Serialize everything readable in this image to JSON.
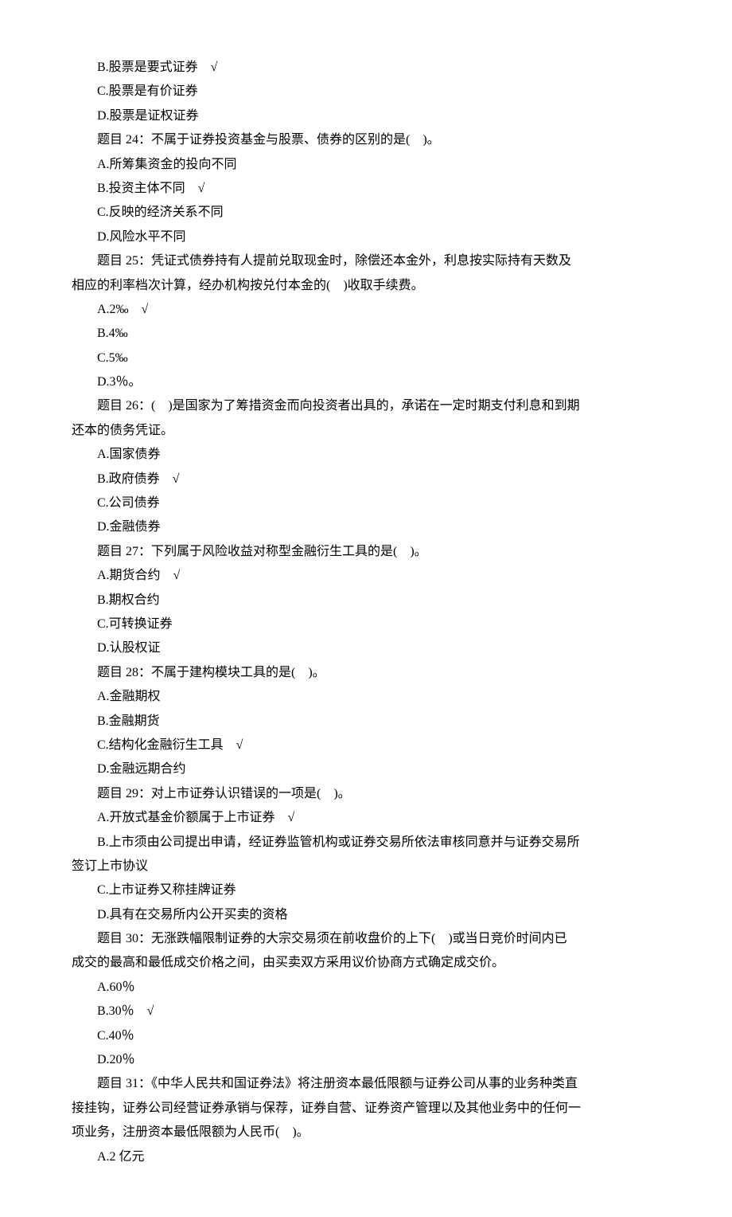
{
  "lines": [
    {
      "indent": true,
      "text": "B.股票是要式证券　√"
    },
    {
      "indent": true,
      "text": "C.股票是有价证券"
    },
    {
      "indent": true,
      "text": "D.股票是证权证券"
    },
    {
      "indent": true,
      "text": "题目 24：不属于证券投资基金与股票、债券的区别的是(　)。"
    },
    {
      "indent": true,
      "text": "A.所筹集资金的投向不同"
    },
    {
      "indent": true,
      "text": "B.投资主体不同　√"
    },
    {
      "indent": true,
      "text": "C.反映的经济关系不同"
    },
    {
      "indent": true,
      "text": "D.风险水平不同"
    },
    {
      "indent": true,
      "text": "题目 25：凭证式债券持有人提前兑取现金时，除偿还本金外，利息按实际持有天数及"
    },
    {
      "indent": false,
      "text": "相应的利率档次计算，经办机构按兑付本金的(　)收取手续费。"
    },
    {
      "indent": true,
      "text": "A.2‰　√"
    },
    {
      "indent": true,
      "text": "B.4‰"
    },
    {
      "indent": true,
      "text": "C.5‰"
    },
    {
      "indent": true,
      "text": "D.3％。"
    },
    {
      "indent": true,
      "text": "题目 26：(　)是国家为了筹措资金而向投资者出具的，承诺在一定时期支付利息和到期"
    },
    {
      "indent": false,
      "text": "还本的债务凭证。"
    },
    {
      "indent": true,
      "text": "A.国家债券"
    },
    {
      "indent": true,
      "text": "B.政府债券　√"
    },
    {
      "indent": true,
      "text": "C.公司债券"
    },
    {
      "indent": true,
      "text": "D.金融债券"
    },
    {
      "indent": true,
      "text": "题目 27：下列属于风险收益对称型金融衍生工具的是(　)。"
    },
    {
      "indent": true,
      "text": "A.期货合约　√"
    },
    {
      "indent": true,
      "text": "B.期权合约"
    },
    {
      "indent": true,
      "text": "C.可转换证券"
    },
    {
      "indent": true,
      "text": "D.认股权证"
    },
    {
      "indent": true,
      "text": "题目 28：不属于建构模块工具的是(　)。"
    },
    {
      "indent": true,
      "text": "A.金融期权"
    },
    {
      "indent": true,
      "text": "B.金融期货"
    },
    {
      "indent": true,
      "text": "C.结构化金融衍生工具　√"
    },
    {
      "indent": true,
      "text": "D.金融远期合约"
    },
    {
      "indent": true,
      "text": "题目 29：对上市证券认识错误的一项是(　)。"
    },
    {
      "indent": true,
      "text": "A.开放式基金价额属于上市证券　√"
    },
    {
      "indent": true,
      "text": "B.上市须由公司提出申请，经证券监管机构或证券交易所依法审核同意并与证券交易所"
    },
    {
      "indent": false,
      "text": "签订上市协议"
    },
    {
      "indent": true,
      "text": "C.上市证券又称挂牌证券"
    },
    {
      "indent": true,
      "text": "D.具有在交易所内公开买卖的资格"
    },
    {
      "indent": true,
      "text": "题目 30：无涨跌幅限制证券的大宗交易须在前收盘价的上下(　)或当日竞价时间内已"
    },
    {
      "indent": false,
      "text": "成交的最高和最低成交价格之间，由买卖双方采用议价协商方式确定成交价。"
    },
    {
      "indent": true,
      "text": "A.60％"
    },
    {
      "indent": true,
      "text": "B.30％　√"
    },
    {
      "indent": true,
      "text": "C.40％"
    },
    {
      "indent": true,
      "text": "D.20％"
    },
    {
      "indent": true,
      "text": "题目 31：《中华人民共和国证券法》将注册资本最低限额与证券公司从事的业务种类直"
    },
    {
      "indent": false,
      "text": "接挂钩，证券公司经营证券承销与保荐，证券自营、证券资产管理以及其他业务中的任何一"
    },
    {
      "indent": false,
      "text": "项业务，注册资本最低限额为人民币(　)。"
    },
    {
      "indent": true,
      "text": "A.2 亿元"
    }
  ]
}
